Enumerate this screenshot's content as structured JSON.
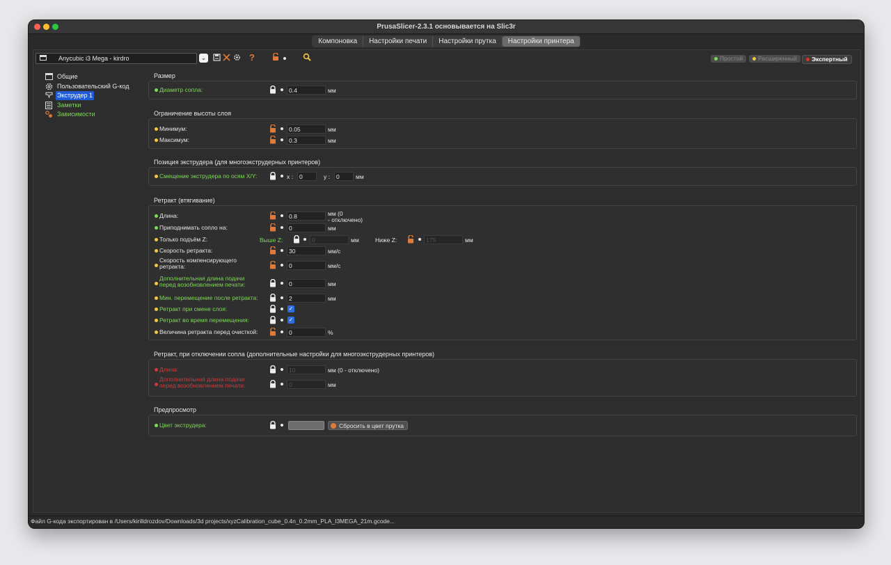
{
  "window": {
    "title": "PrusaSlicer-2.3.1 основывается на Slic3r"
  },
  "tabs": [
    {
      "label": "Компоновка"
    },
    {
      "label": "Настройки печати"
    },
    {
      "label": "Настройки прутка"
    },
    {
      "label": "Настройки принтера"
    }
  ],
  "toolbar": {
    "preset": "Anycubic i3 Mega - kirdro",
    "dropdown_glyph": "⌄",
    "question_glyph": "?"
  },
  "modes": [
    {
      "label": "Простой",
      "color": "#7ed957"
    },
    {
      "label": "Расширенный",
      "color": "#f2c744"
    },
    {
      "label": "Экспертный",
      "color": "#d9332a"
    }
  ],
  "tree": [
    {
      "label": "Общие",
      "icon": "printer-icon"
    },
    {
      "label": "Пользовательский G-код",
      "icon": "gear-icon"
    },
    {
      "label": "Экструдер 1",
      "icon": "extruder-icon"
    },
    {
      "label": "Заметки",
      "icon": "notes-icon"
    },
    {
      "label": "Зависимости",
      "icon": "dependencies-icon"
    }
  ],
  "sections": {
    "size": {
      "title": "Размер",
      "nozzle_diameter": {
        "label": "Диаметр сопла:",
        "value": "0.4",
        "unit": "мм"
      }
    },
    "layer_height": {
      "title": "Ограничение высоты слоя",
      "min": {
        "label": "Минимум:",
        "value": "0.05",
        "unit": "мм"
      },
      "max": {
        "label": "Максимум:",
        "value": "0.3",
        "unit": "мм"
      }
    },
    "position": {
      "title": "Позиция экструдера (для многоэкструдерных принтеров)",
      "offset": {
        "label": "Смещение экструдера по осям X/Y:",
        "x_label": "x :",
        "x_value": "0",
        "y_label": "y :",
        "y_value": "0",
        "unit": "мм"
      }
    },
    "retraction": {
      "title": "Ретракт (втягивание)",
      "length": {
        "label": "Длина:",
        "value": "0.8",
        "unit_line1": "мм (0",
        "unit_line2": "- отключено)"
      },
      "lift": {
        "label": "Приподнимать сопло на:",
        "value": "0",
        "unit": "мм"
      },
      "only_lift": {
        "label": "Только подъём Z:",
        "above_label": "Выше Z:",
        "above_value": "0",
        "above_unit": "мм",
        "below_label": "Ниже Z:",
        "below_value": "175",
        "below_unit": "мм"
      },
      "speed": {
        "label": "Скорость ретракта:",
        "value": "30",
        "unit": "мм/с"
      },
      "deretract_speed": {
        "label_line1": "Скорость компенсирующего",
        "label_line2": "ретракта:",
        "value": "0",
        "unit": "мм/с"
      },
      "extra_length": {
        "label_line1": "Дополнительная длина подачи",
        "label_line2": "перед возобновлением печати:",
        "value": "0",
        "unit": "мм"
      },
      "min_travel": {
        "label": "Мин. перемещение после ретракта:",
        "value": "2",
        "unit": "мм"
      },
      "layer_change": {
        "label": "Ретракт при смене слоя:",
        "check": "✓"
      },
      "wipe": {
        "label": "Ретракт во время перемещения:",
        "check": "✓"
      },
      "before_wipe": {
        "label": "Величина ретракта перед очисткой:",
        "value": "0",
        "unit": "%"
      }
    },
    "retraction_disabled": {
      "title": "Ретракт, при отключении сопла (дополнительные настройки для многоэкструдерных принтеров)",
      "length": {
        "label": "Длина:",
        "value": "10",
        "unit": "мм (0 - отключено)"
      },
      "extra": {
        "label_line1": "Дополнительная длина подачи",
        "label_line2": "перед возобновлением печати:",
        "value": "0",
        "unit": "мм"
      }
    },
    "preview": {
      "title": "Предпросмотр",
      "color": {
        "label": "Цвет экструдера:",
        "reset_label": "Сбросить в цвет прутка"
      }
    }
  },
  "statusbar": {
    "text": "Файл G-кода экспортирован в /Users/kirilldrozdov/Downloads/3d projects/xyzCalibration_cube_0.4n_0.2mm_PLA_I3MEGA_21m.gcode..."
  },
  "colors": {
    "green": "#7ed957",
    "yellow": "#f2c744",
    "red": "#cc3b3b",
    "orange_lock": "#e07a3a",
    "selection": "#1f5bd6"
  }
}
